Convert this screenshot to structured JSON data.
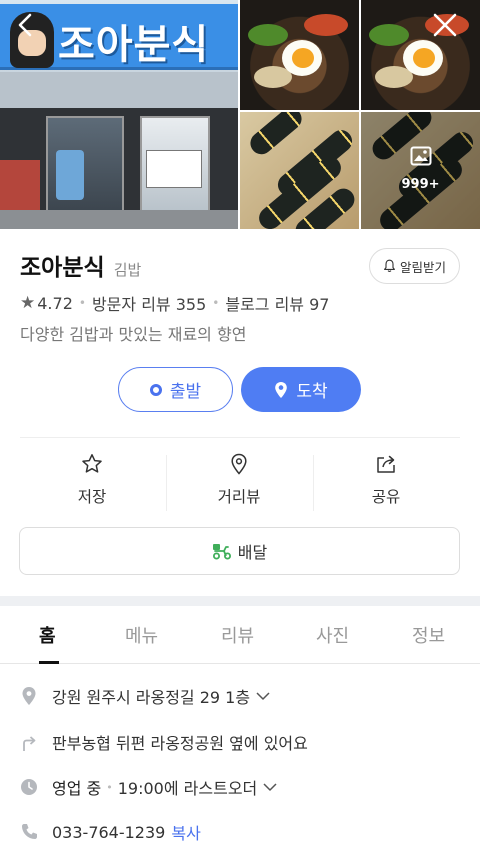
{
  "photos": {
    "storefront_sign": "조아분식",
    "more_count": "999+"
  },
  "place": {
    "name": "조아분식",
    "category": "김밥",
    "notify_label": "알림받기",
    "rating": "4.72",
    "visitor_reviews": "방문자 리뷰 355",
    "blog_reviews": "블로그 리뷰 97",
    "description": "다양한 김밥과 맛있는 재료의 향연"
  },
  "route": {
    "departure_label": "출발",
    "arrival_label": "도착"
  },
  "actions": {
    "save_label": "저장",
    "street_view_label": "거리뷰",
    "share_label": "공유",
    "delivery_label": "배달"
  },
  "tabs": [
    {
      "label": "홈",
      "active": true
    },
    {
      "label": "메뉴",
      "active": false
    },
    {
      "label": "리뷰",
      "active": false
    },
    {
      "label": "사진",
      "active": false
    },
    {
      "label": "정보",
      "active": false
    }
  ],
  "details": {
    "address": "강원 원주시 라옹정길 29 1층",
    "directions": "판부농협 뒤편 라옹정공원 옆에 있어요",
    "hours_status": "영업 중",
    "hours_text": "19:00에 라스트오더",
    "phone": "033-764-1239",
    "copy_label": "복사"
  },
  "colors": {
    "accent": "#4f7df3",
    "delivery_icon": "#3fae5a"
  }
}
